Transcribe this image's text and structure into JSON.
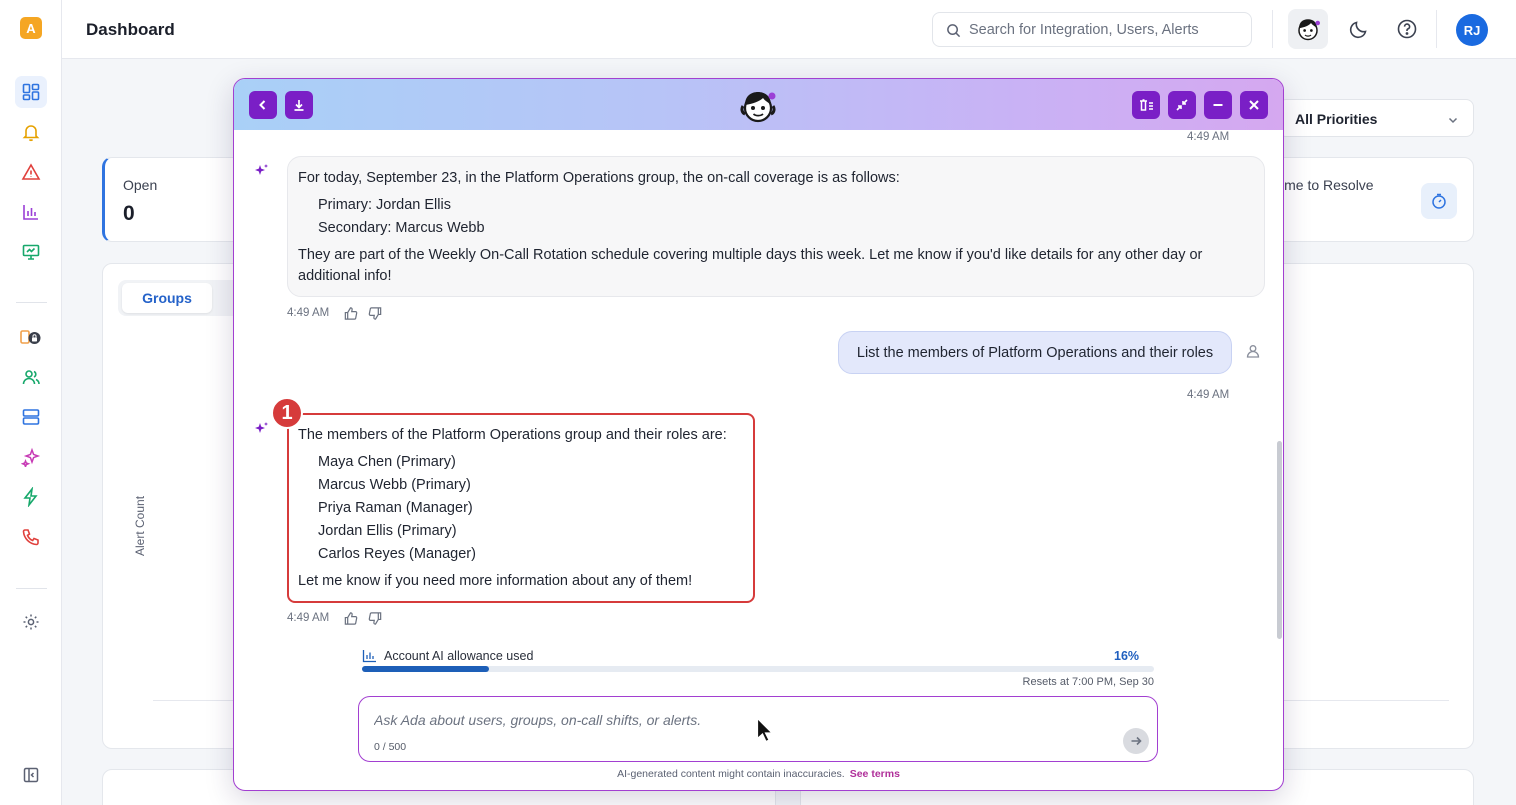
{
  "header": {
    "title": "Dashboard",
    "search_placeholder": "Search for Integration, Users, Alerts",
    "user_initials": "RJ"
  },
  "dashboard": {
    "priority_filter": "All Priorities",
    "open_label": "Open",
    "open_value": "0",
    "ttr_label": "ime to Resolve",
    "tab_groups": "Groups",
    "y_axis_label": "Alert Count"
  },
  "chat": {
    "messages": {
      "ai1": {
        "time_top": "4:49 AM",
        "intro": "For today, September 23, in the Platform Operations group, the on-call coverage is as follows:",
        "primary": "Primary: Jordan Ellis",
        "secondary": "Secondary: Marcus Webb",
        "outro_line1": "They are part of the Weekly On-Call Rotation schedule covering multiple days this week. Let me know if you'd like details for any other day or",
        "outro_line2": "additional info!",
        "time": "4:49 AM"
      },
      "user": {
        "text": "List the members of Platform Operations and their roles",
        "time": "4:49 AM"
      },
      "ai2": {
        "intro": "The members of the Platform Operations group and their roles are:",
        "members": [
          "Maya Chen (Primary)",
          "Marcus Webb (Primary)",
          "Priya Raman (Manager)",
          "Jordan Ellis (Primary)",
          "Carlos Reyes (Manager)"
        ],
        "outro": "Let me know if you need more information about any of them!",
        "time": "4:49 AM",
        "annotation_number": "1"
      }
    },
    "allowance": {
      "label": "Account AI allowance used",
      "percent_text": "16%",
      "percent_value": 0.16,
      "resets": "Resets at 7:00 PM, Sep 30"
    },
    "composer": {
      "placeholder": "Ask Ada about users, groups, on-call shifts, or alerts.",
      "count": "0 / 500"
    },
    "disclaimer": "AI-generated content might contain inaccuracies.",
    "terms_link": "See terms"
  },
  "colors": {
    "accent_purple": "#7a1fc6",
    "primary_blue": "#1a6ae0",
    "annotation_red": "#d63b3b"
  },
  "icons": [
    "grid-icon",
    "bell-icon",
    "warning-icon",
    "bar-chart-icon",
    "monitor-icon",
    "lock-integrations-icon",
    "users-icon",
    "server-icon",
    "sparkles-icon",
    "bolt-icon",
    "phone-icon",
    "gear-icon",
    "collapse-sidebar-icon"
  ]
}
